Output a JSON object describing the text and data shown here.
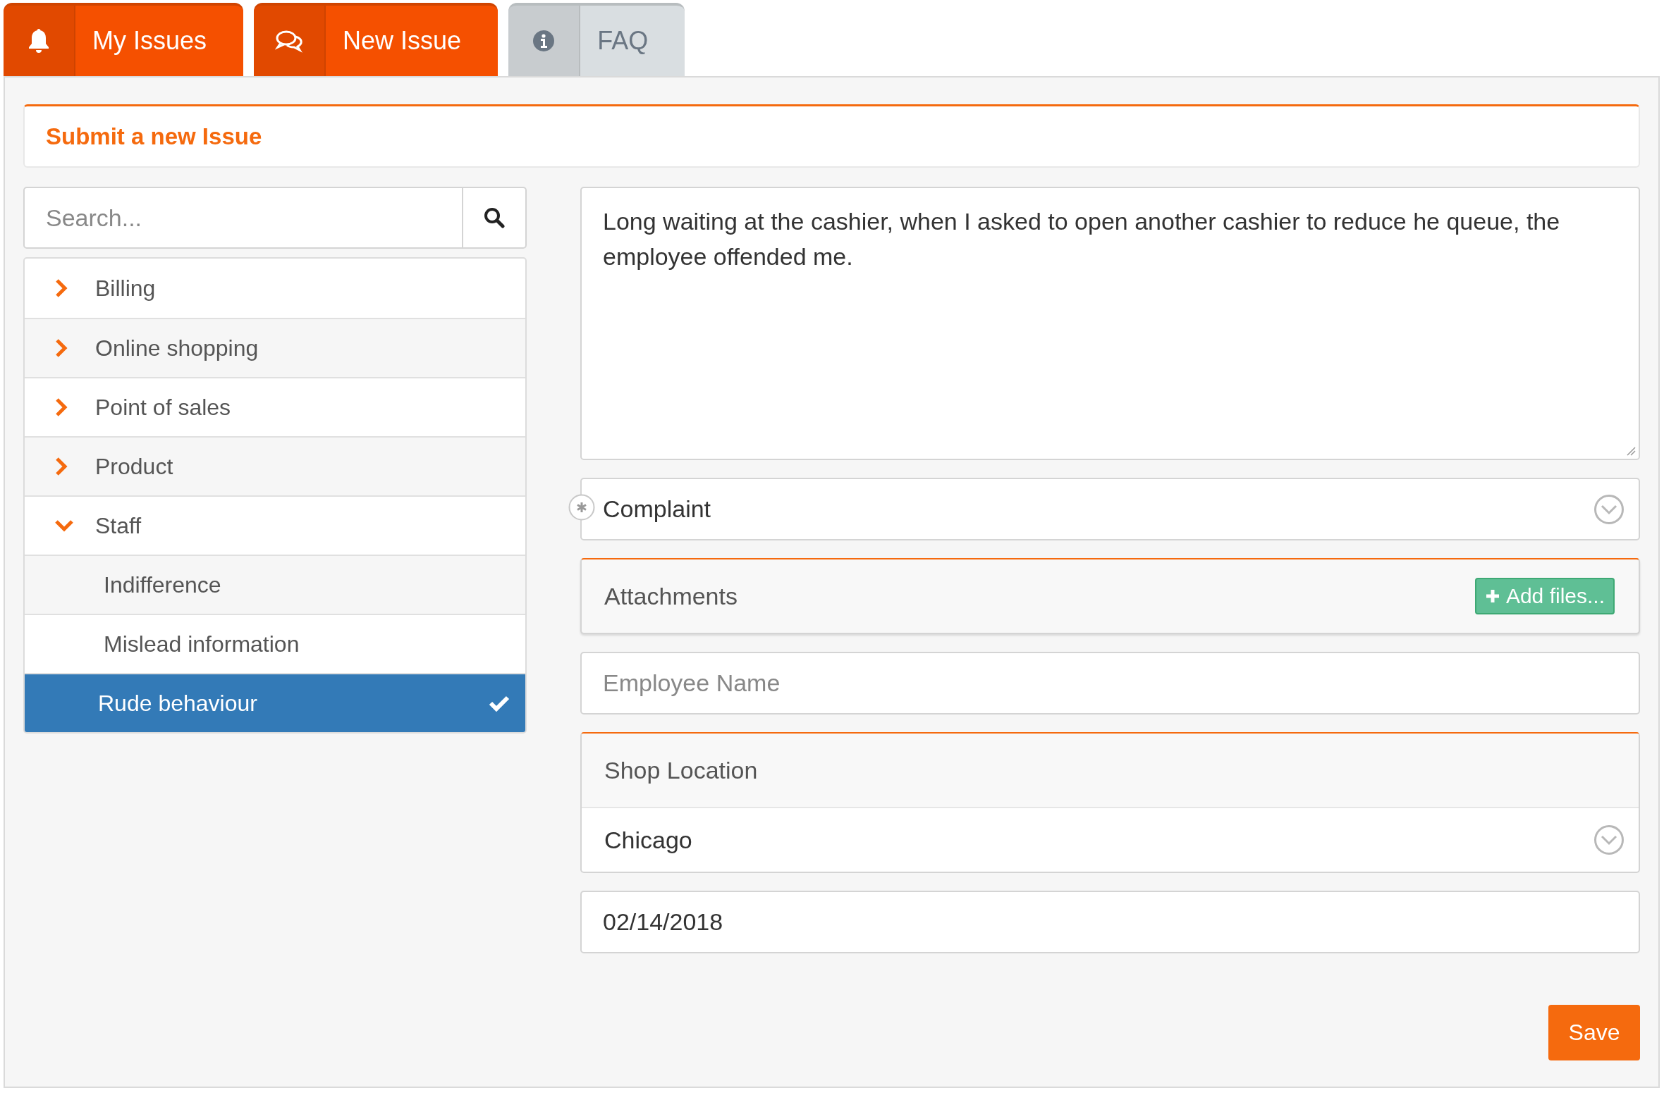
{
  "tabs": [
    {
      "label": "My Issues",
      "color": "#f55000"
    },
    {
      "label": "New Issue",
      "color": "#f55000"
    },
    {
      "label": "FAQ",
      "color": "#d9dee1"
    }
  ],
  "panel": {
    "title": "Submit a new Issue"
  },
  "search": {
    "placeholder": "Search..."
  },
  "categories": [
    {
      "label": "Billing",
      "expanded": false
    },
    {
      "label": "Online shopping",
      "expanded": false
    },
    {
      "label": "Point of sales",
      "expanded": false
    },
    {
      "label": "Product",
      "expanded": false
    },
    {
      "label": "Staff",
      "expanded": true,
      "children": [
        {
          "label": "Indifference",
          "selected": false
        },
        {
          "label": "Mislead information",
          "selected": false
        },
        {
          "label": "Rude behaviour",
          "selected": true
        }
      ]
    }
  ],
  "form": {
    "description": "Long waiting at the cashier, when I asked to open another cashier to reduce he queue, the employee offended me.",
    "issue_type": {
      "value": "Complaint",
      "required": true
    },
    "attachments": {
      "label": "Attachments",
      "button": "Add files..."
    },
    "employee_name": {
      "placeholder": "Employee Name"
    },
    "shop_location": {
      "label": "Shop Location",
      "value": "Chicago"
    },
    "date": {
      "value": "02/14/2018"
    },
    "save_button": "Save"
  }
}
